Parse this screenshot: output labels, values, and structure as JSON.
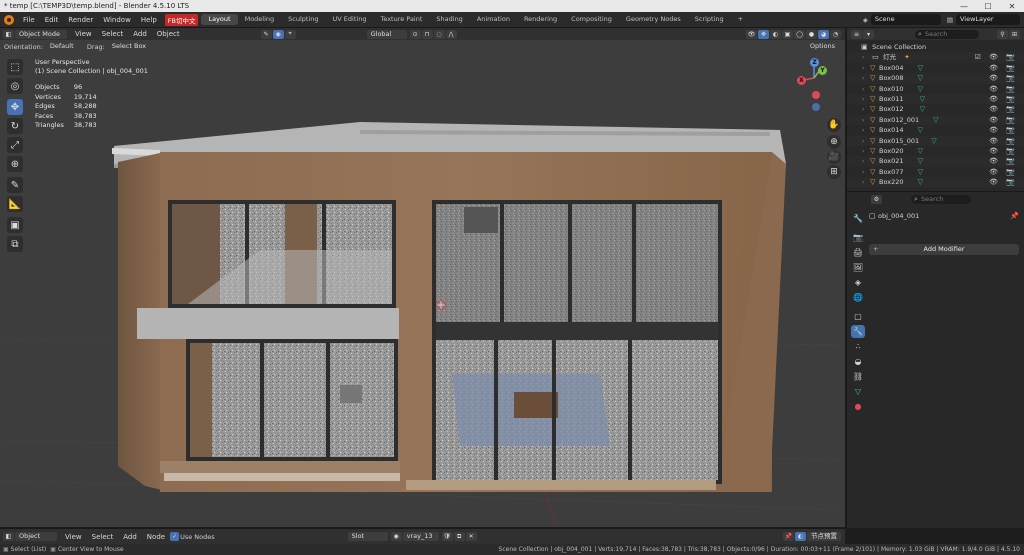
{
  "window": {
    "title": "* temp [C:\\TEMP3D\\temp.blend] - Blender 4.5.10 LTS",
    "controls": [
      "—",
      "☐",
      "✕"
    ]
  },
  "menu": {
    "items": [
      "File",
      "Edit",
      "Render",
      "Window",
      "Help"
    ],
    "cn_badge": "FB切中文",
    "workspaces": [
      "Layout",
      "Modeling",
      "Sculpting",
      "UV Editing",
      "Texture Paint",
      "Shading",
      "Animation",
      "Rendering",
      "Compositing",
      "Geometry Nodes",
      "Scripting",
      "+"
    ],
    "active_workspace": "Layout",
    "scene": "Scene",
    "view_layer": "ViewLayer"
  },
  "viewport_header": {
    "mode": "Object Mode",
    "menus": [
      "View",
      "Select",
      "Add",
      "Object"
    ],
    "transform_orientation": "Global",
    "orientation_label": "Orientation:",
    "orientation_value": "Default",
    "drag_label": "Drag:",
    "drag_value": "Select Box",
    "options": "Options"
  },
  "overlay": {
    "view_name": "User Perspective",
    "collection_path": "(1) Scene Collection | obj_004_001",
    "stats": [
      {
        "label": "Objects",
        "value": "96"
      },
      {
        "label": "Vertices",
        "value": "19,714"
      },
      {
        "label": "Edges",
        "value": "58,288"
      },
      {
        "label": "Faces",
        "value": "38,783"
      },
      {
        "label": "Triangles",
        "value": "38,783"
      }
    ]
  },
  "gizmo": {
    "x": "X",
    "y": "Y",
    "z": "Z"
  },
  "outliner": {
    "search_placeholder": "Search",
    "root": "Scene Collection",
    "items": [
      {
        "name": "灯光",
        "type": "collection"
      },
      {
        "name": "Box004",
        "type": "mesh"
      },
      {
        "name": "Box008",
        "type": "mesh"
      },
      {
        "name": "Box010",
        "type": "mesh"
      },
      {
        "name": "Box011",
        "type": "mesh"
      },
      {
        "name": "Box012",
        "type": "mesh"
      },
      {
        "name": "Box012_001",
        "type": "mesh"
      },
      {
        "name": "Box014",
        "type": "mesh"
      },
      {
        "name": "Box015_001",
        "type": "mesh"
      },
      {
        "name": "Box020",
        "type": "mesh"
      },
      {
        "name": "Box021",
        "type": "mesh"
      },
      {
        "name": "Box077",
        "type": "mesh"
      },
      {
        "name": "Box220",
        "type": "mesh"
      }
    ]
  },
  "properties": {
    "search_placeholder": "Search",
    "object_name": "obj_004_001",
    "add_modifier": "Add Modifier"
  },
  "shader_header": {
    "mode": "Object",
    "menus": [
      "View",
      "Select",
      "Add",
      "Node"
    ],
    "use_nodes_label": "Use Nodes",
    "slot": "Slot",
    "material": "vray_13",
    "cn_button": "节点预置"
  },
  "statusbar": {
    "left1": "Select (List)",
    "left2": "Center View to Mouse",
    "right": "Scene Collection | obj_004_001 | Verts:19,714 | Faces:38,783 | Tris:38,783 | Objects:0/96 | Duration: 00:03+11 (Frame 2/101) | Memory: 1.03 GiB | VRAM: 1.9/4.0 GiB | 4.5.10"
  },
  "colors": {
    "accent": "#4772b3",
    "blender_orange": "#e87d0d",
    "wood": "#8d6b52",
    "concrete": "#a9a9a9"
  }
}
